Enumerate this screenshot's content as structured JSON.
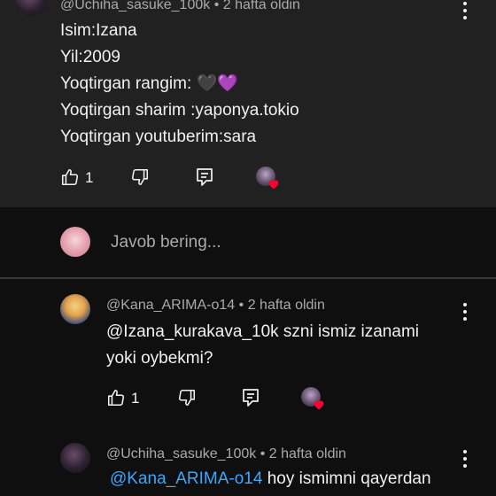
{
  "comment1": {
    "author": "@Uchiha_sasuke_100k",
    "time": "• 2 hafta oldin",
    "lines": [
      "Isim:Izana",
      "Yil:2009",
      "Yoqtirgan rangim:",
      "Yoqtirgan sharim :yaponya.tokio",
      "Yoqtirgan youtuberim:sara"
    ],
    "emojis": "🖤💜",
    "like_count": "1"
  },
  "reply_box": {
    "placeholder": "Javob bering..."
  },
  "reply1": {
    "author": "@Kana_ARIMA-o14",
    "time": "• 2 hafta oldin",
    "lines": [
      "@Izana_kurakava_10k szni ismiz izanami",
      "yoki oybekmi?"
    ],
    "like_count": "1"
  },
  "reply2": {
    "author": "@Uchiha_sasuke_100k",
    "time": "• 2 hafta oldin",
    "mention": "@Kana_ARIMA-o14",
    "text": "hoy ismimni qayerdan"
  },
  "colors": {
    "background": "#0f0f0f",
    "comment_background": "#212121",
    "mention": "#3ea6ff",
    "heart": "#ff0033"
  },
  "icons": [
    "thumbs-up-icon",
    "thumbs-down-icon",
    "reply-icon",
    "creator-heart-icon",
    "more-vert-icon"
  ]
}
